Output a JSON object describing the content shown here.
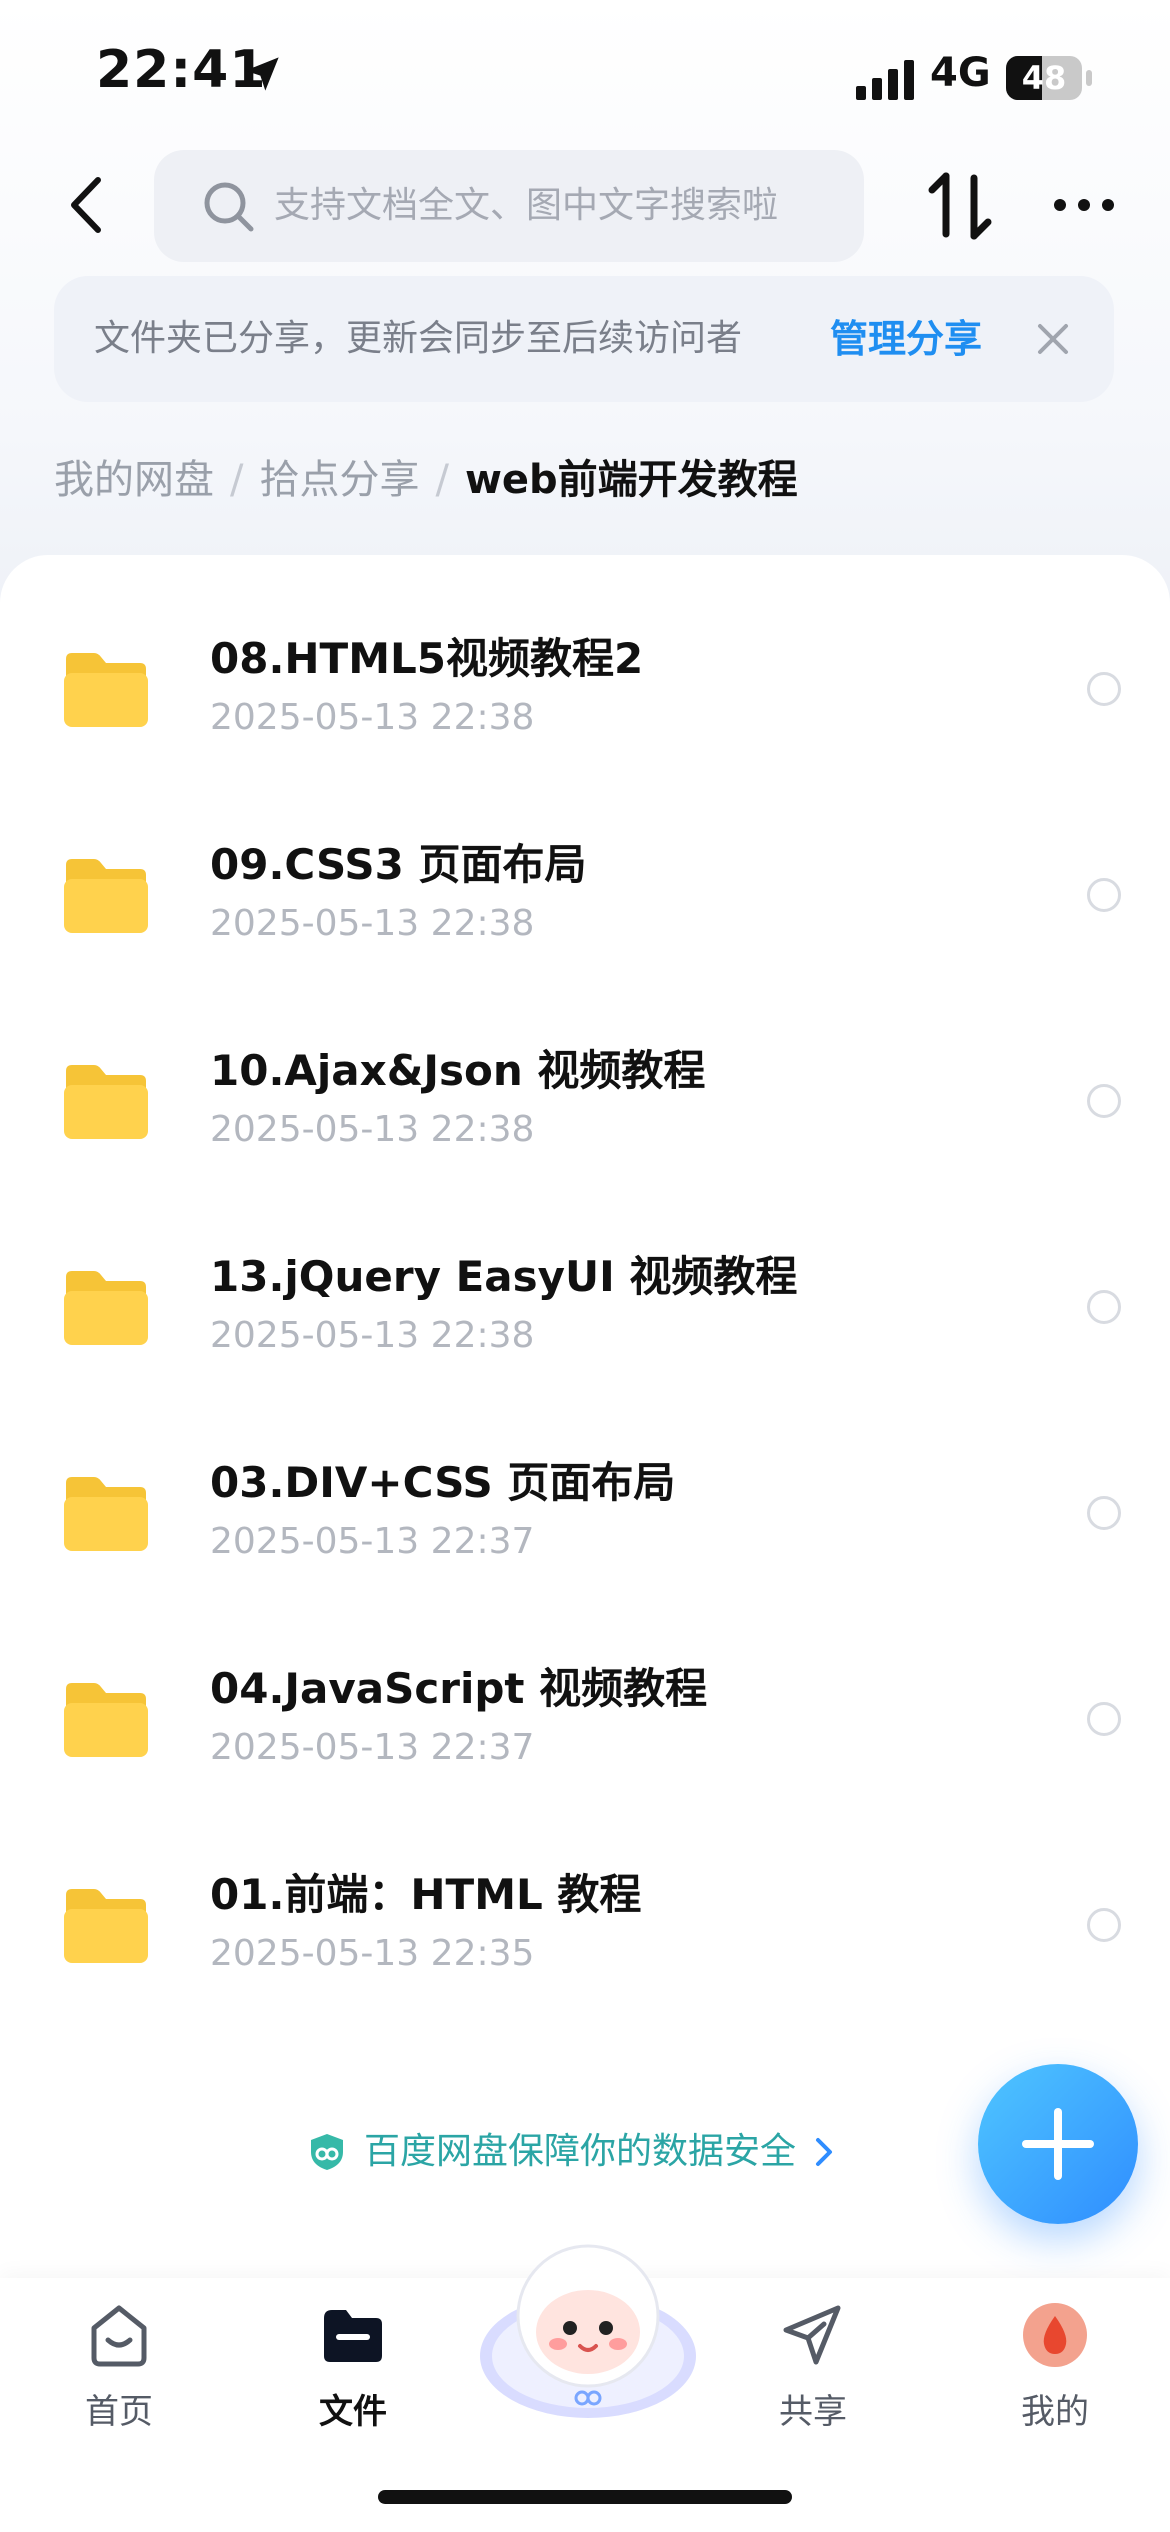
{
  "status_bar": {
    "time": "22:41",
    "network": "4G",
    "battery_percent": 48,
    "battery_label": "48"
  },
  "header": {
    "search_placeholder": "支持文档全文、图中文字搜索啦"
  },
  "share_banner": {
    "text": "文件夹已分享，更新会同步至后续访问者",
    "link_label": "管理分享"
  },
  "breadcrumb": {
    "items": [
      "我的网盘",
      "拾点分享",
      "web前端开发教程"
    ],
    "separator": "/"
  },
  "files": [
    {
      "name": "08.HTML5视频教程2",
      "date": "2025-05-13 22:38"
    },
    {
      "name": "09.CSS3 页面布局",
      "date": "2025-05-13 22:38"
    },
    {
      "name": "10.Ajax&Json 视频教程",
      "date": "2025-05-13 22:38"
    },
    {
      "name": "13.jQuery EasyUI 视频教程",
      "date": "2025-05-13 22:38"
    },
    {
      "name": "03.DIV+CSS 页面布局",
      "date": "2025-05-13 22:37"
    },
    {
      "name": "04.JavaScript 视频教程",
      "date": "2025-05-13 22:37"
    },
    {
      "name": "01.前端：HTML 教程",
      "date": "2025-05-13 22:35"
    }
  ],
  "safety_notice": "百度网盘保障你的数据安全",
  "tabs": [
    {
      "label": "首页",
      "icon": "home-icon"
    },
    {
      "label": "文件",
      "icon": "folder-icon"
    },
    {
      "label": "共享",
      "icon": "send-icon"
    },
    {
      "label": "我的",
      "icon": "profile-icon"
    }
  ],
  "colors": {
    "accent": "#1f8ef1",
    "folder": "#ffd24d",
    "safety": "#2ba5a5",
    "fab_start": "#4fc6ff",
    "fab_end": "#2f8dff"
  }
}
